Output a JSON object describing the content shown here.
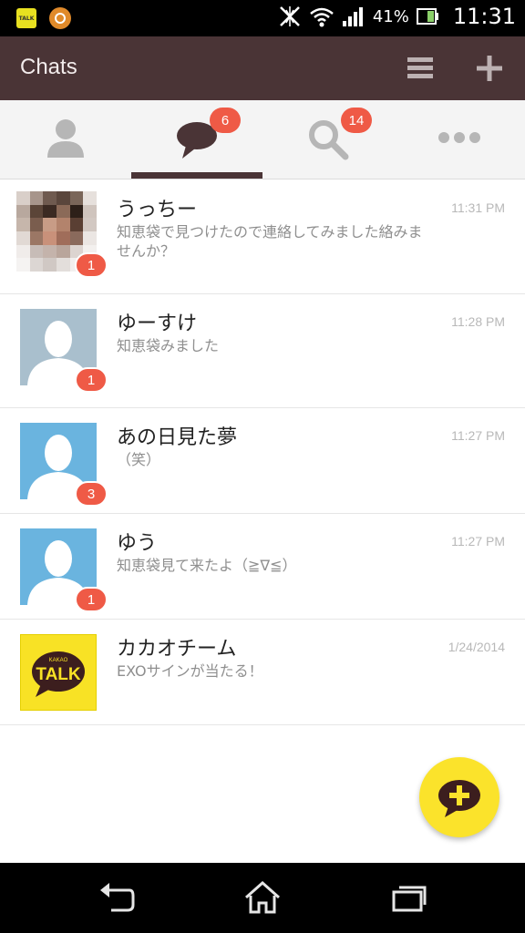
{
  "status_bar": {
    "battery_percent": "41%",
    "time": "11:31",
    "talk_icon_text": "TALK",
    "icons": [
      "kakaotalk-notification-icon",
      "circle-app-icon",
      "nfc-icon",
      "wifi-icon",
      "signal-icon",
      "battery-icon"
    ]
  },
  "header": {
    "title": "Chats",
    "menu_icon": "hamburger-menu-icon",
    "add_icon": "plus-icon"
  },
  "tabs": [
    {
      "name": "friends",
      "icon": "person-icon",
      "badge": ""
    },
    {
      "name": "chats",
      "icon": "speech-bubble-icon",
      "badge": "6",
      "active": true
    },
    {
      "name": "find",
      "icon": "search-icon",
      "badge": "14"
    },
    {
      "name": "more",
      "icon": "more-dots-icon",
      "badge": ""
    }
  ],
  "chats": [
    {
      "name": "うっちー",
      "message": "知恵袋で見つけたので連絡してみました絡みませんか？",
      "time": "11:31 PM",
      "unread": "1",
      "avatar": "mosaic-photo"
    },
    {
      "name": "ゆーすけ",
      "message": "知恵袋みました",
      "time": "11:28 PM",
      "unread": "1",
      "avatar": "default-gray"
    },
    {
      "name": "あの日見た夢",
      "message": "（笑）",
      "time": "11:27 PM",
      "unread": "3",
      "avatar": "default-blue"
    },
    {
      "name": "ゆう",
      "message": "知恵袋見て来たよ（≧∇≦）",
      "time": "11:27 PM",
      "unread": "1",
      "avatar": "default-blue"
    },
    {
      "name": "カカオチーム",
      "message": "EXOサインが当たる！",
      "time": "1/24/2014",
      "unread": "",
      "avatar": "kakao-talk-logo"
    }
  ],
  "kakao_logo": {
    "small_text": "KAKAO",
    "big_text": "TALK"
  },
  "fab": {
    "icon": "new-chat-plus-icon"
  },
  "nav": {
    "back_icon": "back-icon",
    "home_icon": "home-icon",
    "recents_icon": "recent-apps-icon"
  },
  "colors": {
    "app_bar": "#4a3436",
    "badge": "#ef5a46",
    "fab": "#fbe32b",
    "tab_active": "#4a3436",
    "avatar_blue": "#6ab4df",
    "avatar_gray": "#a9bfcd"
  }
}
